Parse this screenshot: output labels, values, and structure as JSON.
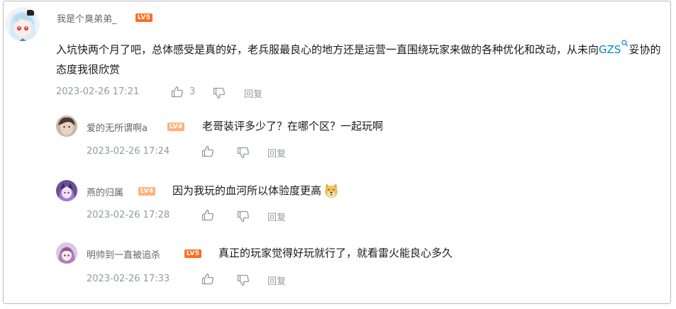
{
  "top_comment": {
    "username": "我是个臭弟弟_",
    "level": "LV5",
    "content_part1": "入坑快两个月了吧，总体感受是真的好，老兵服最良心的地方还是运营一直围绕玩家来做的各种优化和改动，从未向",
    "content_link": "GZS",
    "content_part2": "妥协的态度我很欣赏",
    "time": "2023-02-26 17:21",
    "likes": "3",
    "reply_label": "回复"
  },
  "replies": [
    {
      "username": "爱的无所谓啊a",
      "level": "LV4",
      "content": "老哥装评多少了？在哪个区？一起玩啊",
      "time": "2023-02-26 17:24",
      "reply_label": "回复"
    },
    {
      "username": "燕的归属",
      "level": "LV4",
      "content": "因为我玩的血河所以体验度更高",
      "emoji": "doge-emoji",
      "time": "2023-02-26 17:28",
      "reply_label": "回复"
    },
    {
      "username": "明帅到一直被追杀",
      "level": "LV5",
      "content": "真正的玩家觉得好玩就行了，就看雷火能良心多久",
      "time": "2023-02-26 17:33",
      "reply_label": "回复"
    }
  ],
  "icons": [
    "like-icon",
    "dislike-icon",
    "search-icon",
    "doge-emoji"
  ],
  "colors": {
    "lv5": "#ff6d1f",
    "lv4": "#ffb27a",
    "link": "#008ac5",
    "meta": "#9499a0"
  }
}
